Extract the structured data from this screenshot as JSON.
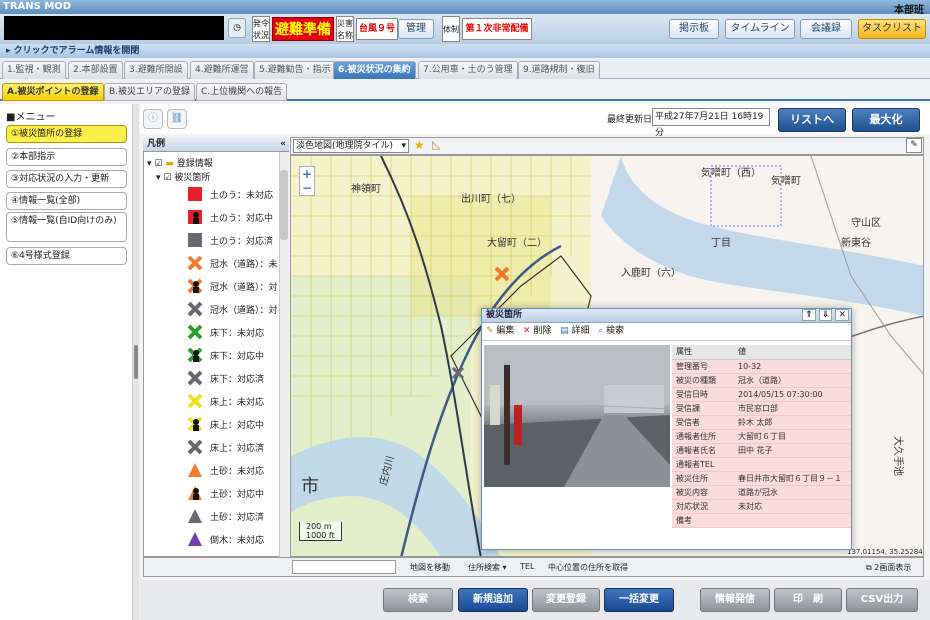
{
  "app": {
    "title": "TRANS MOD",
    "unit": "本部班"
  },
  "header": {
    "label_status": "発令状況",
    "status": "避難準備",
    "label_disaster": "災害名称",
    "disaster": "台風９号",
    "manage": "管理",
    "label_system": "体制",
    "system": "第１次非常配備",
    "buttons": {
      "board": "掲示板",
      "timeline": "タイムライン",
      "minutes": "会議録",
      "tasklist": "タスクリスト"
    }
  },
  "alarm": "クリックでアラーム情報を開閉",
  "tabs_main": [
    "1.監視・観測",
    "2.本部設置",
    "3.避難所開設",
    "4.避難所運営",
    "5.避難勧告・指示",
    "6.被災状況の集約",
    "7.公用車・土のう管理",
    "9.道路規制・復旧"
  ],
  "tabs_sub": [
    "A.被災ポイントの登録",
    "B.被災エリアの登録",
    "C.上位機関への報告"
  ],
  "menu": {
    "title": "■メニュー",
    "items": [
      "①被災箇所の登録",
      "②本部指示",
      "③対応状況の入力・更新",
      "④情報一覧(全部)",
      "⑤情報一覧(自ID向けのみ)",
      "⑥4号様式登録"
    ]
  },
  "toolbar": {
    "updated_label": "最終更新日",
    "updated_value": "平成27年7月21日 16時19分",
    "list_btn": "リストへ",
    "max_btn": "最大化"
  },
  "legend": {
    "title": "凡例",
    "root": "登録情報",
    "group": "被災箇所",
    "items": [
      {
        "label": "土のう：未対応",
        "color": "#e8202a",
        "shape": "square"
      },
      {
        "label": "土のう：対応中",
        "color": "#e8202a",
        "shape": "square-person"
      },
      {
        "label": "土のう：対応済",
        "color": "#666a70",
        "shape": "square"
      },
      {
        "label": "冠水（道路）：未",
        "color": "#f07b2a",
        "shape": "x"
      },
      {
        "label": "冠水（道路）：対",
        "color": "#f07b2a",
        "shape": "x-person"
      },
      {
        "label": "冠水（道路）：対",
        "color": "#666a70",
        "shape": "x"
      },
      {
        "label": "床下：未対応",
        "color": "#2aa02a",
        "shape": "x"
      },
      {
        "label": "床下：対応中",
        "color": "#2aa02a",
        "shape": "x-person"
      },
      {
        "label": "床下：対応済",
        "color": "#666a70",
        "shape": "x"
      },
      {
        "label": "床上：未対応",
        "color": "#f0e020",
        "shape": "x"
      },
      {
        "label": "床上：対応中",
        "color": "#f0e020",
        "shape": "x-person"
      },
      {
        "label": "床上：対応済",
        "color": "#666a70",
        "shape": "x"
      },
      {
        "label": "土砂：未対応",
        "color": "#f07b2a",
        "shape": "tri"
      },
      {
        "label": "土砂：対応中",
        "color": "#f07b2a",
        "shape": "tri-person"
      },
      {
        "label": "土砂：対応済",
        "color": "#666a70",
        "shape": "tri"
      },
      {
        "label": "倒木：未対応",
        "color": "#7040b0",
        "shape": "tri"
      }
    ]
  },
  "map": {
    "layer": "淡色地図(地理院タイル)",
    "scale_m": "200 m",
    "scale_ft": "1000 ft",
    "coords": "137.01154, 35.25284",
    "labels": [
      "出川町（七）",
      "大留町（二）",
      "神領町",
      "気噌町（西）",
      "気噌町",
      "守山区",
      "庄内川",
      "市",
      "大久手池",
      "新東谷",
      "丁目",
      "入鹿町（六）"
    ]
  },
  "mapfoot": {
    "move": "地図を移動",
    "search": "住所検索",
    "tel": "TEL",
    "center": "中心位置の住所を取得",
    "dual": "2画面表示"
  },
  "popup": {
    "title": "被災箇所",
    "edit": "編集",
    "delete": "削除",
    "detail": "詳細",
    "search": "検索",
    "col_attr": "属性",
    "col_val": "値",
    "rows": [
      {
        "k": "管理番号",
        "v": "10-32"
      },
      {
        "k": "被災の種類",
        "v": "冠水（道路）"
      },
      {
        "k": "受信日時",
        "v": "2014/05/15 07:30:00"
      },
      {
        "k": "受信課",
        "v": "市民窓口部"
      },
      {
        "k": "受信者",
        "v": "鈴木 太郎"
      },
      {
        "k": "通報者住所",
        "v": "大留町６丁目"
      },
      {
        "k": "通報者氏名",
        "v": "田中 花子"
      },
      {
        "k": "通報者TEL",
        "v": ""
      },
      {
        "k": "被災住所",
        "v": "春日井市大留町６丁目９－１"
      },
      {
        "k": "被災内容",
        "v": "道路が冠水"
      },
      {
        "k": "対応状況",
        "v": "未対応"
      },
      {
        "k": "備考",
        "v": ""
      }
    ]
  },
  "bottom": {
    "search": "検索",
    "add": "新規追加",
    "change": "変更登録",
    "batch": "一括変更",
    "send": "情報発信",
    "print": "印　刷",
    "csv": "CSV出力"
  },
  "colors": {
    "accent": "#3a74b8",
    "highlight": "#fbf04b",
    "alert": "#e60012"
  }
}
